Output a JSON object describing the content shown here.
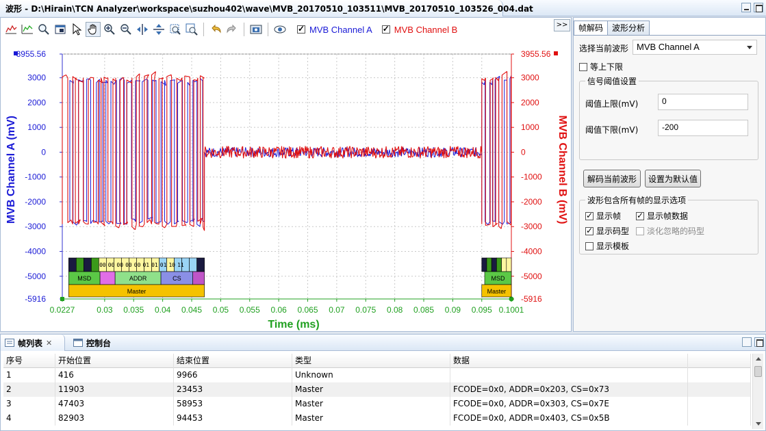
{
  "window": {
    "tab_title": "波形 - D:\\Hirain\\TCN Analyzer\\workspace\\suzhou402\\wave\\MVB_20170510_103511\\MVB_20170510_103526_004.dat"
  },
  "toolbar": {
    "icons": [
      "chart-bar-icon",
      "chart-line-icon",
      "zoom-fit-icon",
      "window-icon",
      "pointer-icon",
      "hand-icon",
      "zoom-in-icon",
      "zoom-out-icon",
      "split-horizontal-icon",
      "split-vertical-icon",
      "zoom-region-icon",
      "zoom-region-2-icon",
      "undo-icon",
      "redo-icon",
      "screenshot-icon",
      "eye-icon"
    ],
    "channel_a": {
      "label": "MVB Channel A",
      "checked": true,
      "color": "#1a1ad6"
    },
    "channel_b": {
      "label": "MVB Channel B",
      "checked": true,
      "color": "#e01010"
    },
    "expand_label": ">>"
  },
  "chart_data": {
    "type": "line",
    "title": "",
    "xlabel": "Time (ms)",
    "ylabel_left": "MVB Channel A (mV)",
    "ylabel_right": "MVB Channel B (mV)",
    "x_range": [
      0.0227,
      0.1001
    ],
    "x_ticks": [
      "0.0227",
      "0.03",
      "0.035",
      "0.04",
      "0.045",
      "0.05",
      "0.055",
      "0.06",
      "0.065",
      "0.07",
      "0.075",
      "0.08",
      "0.085",
      "0.09",
      "0.095",
      "0.1001"
    ],
    "x_tick_values": [
      0.0227,
      0.03,
      0.035,
      0.04,
      0.045,
      0.05,
      0.055,
      0.06,
      0.065,
      0.07,
      0.075,
      0.08,
      0.085,
      0.09,
      0.095,
      0.1001
    ],
    "y_range": [
      -5916,
      3955.56
    ],
    "y_ticks_left": [
      "3955.56",
      "3000",
      "2000",
      "1000",
      "0",
      "-1000",
      "-2000",
      "-3000",
      "-4000",
      "-5000",
      "-5916"
    ],
    "y_ticks_right": [
      "3955.56",
      "3000",
      "2000",
      "1000",
      "0",
      "-1000",
      "-2000",
      "-3000",
      "-4000",
      "-5000",
      "-5916"
    ],
    "y_tick_values": [
      3955.56,
      3000,
      2000,
      1000,
      0,
      -1000,
      -2000,
      -3000,
      -4000,
      -5000,
      -5916
    ],
    "grid": true,
    "series": [
      {
        "name": "MVB Channel A",
        "color": "#1a1ad6",
        "segments": [
          {
            "type": "square",
            "x_start": 0.024,
            "x_end": 0.0472,
            "high": 2900,
            "low": -2800,
            "half_period": 0.00067
          },
          {
            "type": "flat",
            "x_start": 0.0472,
            "x_end": 0.095,
            "value": 0,
            "noise": 200
          },
          {
            "type": "square",
            "x_start": 0.095,
            "x_end": 0.1001,
            "high": 2900,
            "low": -2800,
            "half_period": 0.00067
          }
        ]
      },
      {
        "name": "MVB Channel B",
        "color": "#e01010",
        "segments": [
          {
            "type": "square",
            "x_start": 0.0227,
            "x_end": 0.0472,
            "high": 3000,
            "low": -2900,
            "half_period": 0.00067
          },
          {
            "type": "flat",
            "x_start": 0.0472,
            "x_end": 0.095,
            "value": 0,
            "noise": 250
          },
          {
            "type": "square",
            "x_start": 0.095,
            "x_end": 0.1001,
            "high": 3000,
            "low": -2900,
            "half_period": 0.00067
          }
        ]
      }
    ],
    "decode_bits": [
      "00",
      "00",
      "00",
      "00",
      "00",
      "01",
      "01",
      "01",
      "10",
      "11"
    ],
    "decode_fields_1": [
      {
        "label": "MSD",
        "color": "#5bc846",
        "x_start": 0.0238,
        "x_end": 0.0292
      },
      {
        "label": "",
        "color": "#e06ee6",
        "x_start": 0.0292,
        "x_end": 0.0318
      },
      {
        "label": "ADDR",
        "color": "#8fe08a",
        "x_start": 0.0318,
        "x_end": 0.0397
      },
      {
        "label": "CS",
        "color": "#8a8fe6",
        "x_start": 0.0397,
        "x_end": 0.0452
      },
      {
        "label": "",
        "color": "#c055c8",
        "x_start": 0.0452,
        "x_end": 0.0472
      }
    ],
    "decode_frame_1": {
      "label": "Master",
      "color": "#f5c200",
      "x_start": 0.0238,
      "x_end": 0.0472
    },
    "decode_fields_2": [
      {
        "label": "MSD",
        "color": "#5bc846",
        "x_start": 0.0955,
        "x_end": 0.1001
      }
    ],
    "decode_frame_2": {
      "label": "Master",
      "color": "#f5c200",
      "x_start": 0.095,
      "x_end": 0.1001
    }
  },
  "right_panel": {
    "tabs": [
      "帧解码",
      "波形分析"
    ],
    "select_label": "选择当前波形",
    "select_value": "MVB Channel A",
    "equal_limits_label": "等上下限",
    "threshold_group": "信号阈值设置",
    "upper_label": "阈值上限(mV)",
    "upper_value": "0",
    "lower_label": "阈值下限(mV)",
    "lower_value": "-200",
    "decode_btn": "解码当前波形",
    "default_btn": "设置为默认值",
    "options_group": "波形包含所有帧的显示选项",
    "opt_show_frame": "显示帧",
    "opt_show_frame_data": "显示帧数据",
    "opt_show_code": "显示码型",
    "opt_fade_ignored": "淡化忽略的码型",
    "opt_show_template": "显示模板"
  },
  "bottom_panel": {
    "tabs": [
      "帧列表",
      "控制台"
    ],
    "columns": [
      "序号",
      "开始位置",
      "结束位置",
      "类型",
      "数据",
      ""
    ],
    "rows": [
      [
        "1",
        "416",
        "9966",
        "Unknown",
        "",
        ""
      ],
      [
        "2",
        "11903",
        "23453",
        "Master",
        "FCODE=0x0, ADDR=0x203, CS=0x73",
        ""
      ],
      [
        "3",
        "47403",
        "58953",
        "Master",
        "FCODE=0x0, ADDR=0x303, CS=0x7E",
        ""
      ],
      [
        "4",
        "82903",
        "94453",
        "Master",
        "FCODE=0x0, ADDR=0x403, CS=0x5B",
        ""
      ]
    ]
  }
}
